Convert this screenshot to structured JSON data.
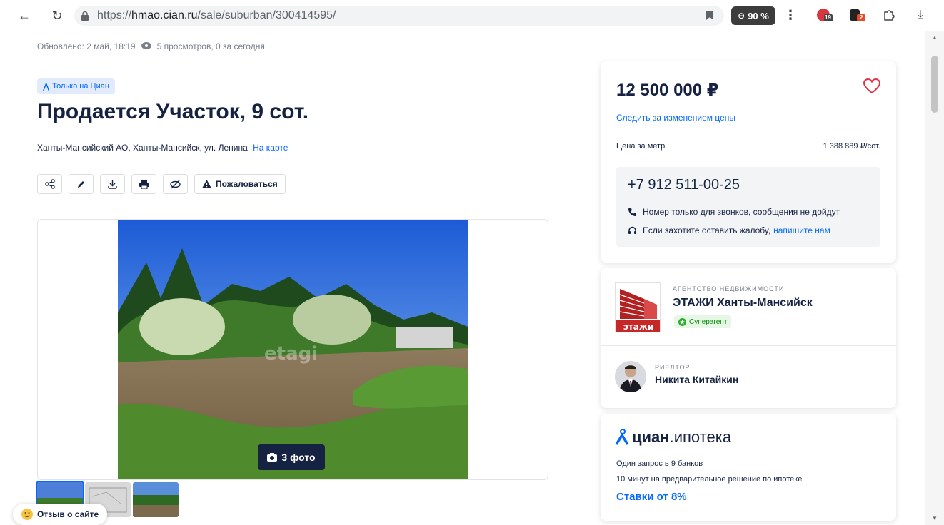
{
  "browser": {
    "url_prefix": "https://",
    "url_host": "hmao.cian.ru",
    "url_path": "/sale/suburban/300414595/",
    "zoom": "90 %",
    "ext_badge_1": "19",
    "ext_badge_2": "2"
  },
  "meta": {
    "updated": "Обновлено: 2 май, 18:19",
    "views": "5 просмотров, 0 за сегодня"
  },
  "listing": {
    "badge": "Только на Циан",
    "title": "Продается Участок, 9 сот.",
    "address": "Ханты-Мансийский АО, Ханты-Мансийск, ул. Ленина",
    "map_link": "На карте",
    "complain_label": "Пожаловаться",
    "photo_count": "3 фото",
    "watermark": "etagi"
  },
  "price_card": {
    "price": "12 500 000 ₽",
    "follow_price": "Следить за изменением цены",
    "price_per_unit_label": "Цена за метр",
    "price_per_unit_value": "1 388 889 ₽/сот.",
    "phone": "+7 912 511-00-25",
    "phone_note": "Номер только для звонков, сообщения не дойдут",
    "complaint_note": "Если захотите оставить жалобу,",
    "complaint_link": "напишите нам"
  },
  "agent": {
    "agency_label": "АГЕНТСТВО НЕДВИЖИМОСТИ",
    "agency_name": "ЭТАЖИ Ханты-Мансийск",
    "agency_logo_text": "этажи",
    "superagent": "Суперагент",
    "realtor_label": "РИЕЛТОР",
    "realtor_name": "Никита Китайкин"
  },
  "mortgage": {
    "logo_bold": "циан",
    "logo_light": ".ипотека",
    "line1": "Один запрос в 9 банков",
    "line2": "10 минут на предварительное решение по ипотеке",
    "rates": "Ставки от 8%"
  },
  "feedback": {
    "label": "Отзыв о сайте"
  }
}
